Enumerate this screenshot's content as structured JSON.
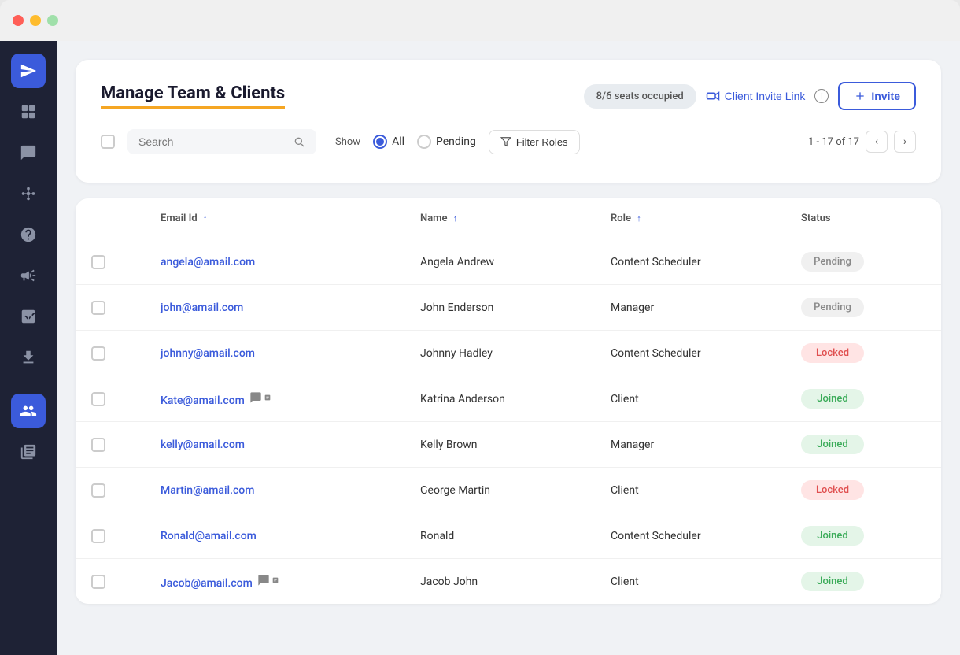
{
  "window": {
    "title": "Manage Team & Clients"
  },
  "header": {
    "title": "Manage Team & Clients",
    "seats_badge": "8/6 seats occupied",
    "invite_link_label": "Client Invite Link",
    "invite_button": "Invite"
  },
  "toolbar": {
    "search_placeholder": "Search",
    "show_label": "Show",
    "filter_button": "Filter Roles",
    "radio_all": "All",
    "radio_pending": "Pending",
    "pagination_text": "1 - 17 of 17"
  },
  "table": {
    "columns": [
      {
        "key": "email",
        "label": "Email Id",
        "sorted": true
      },
      {
        "key": "name",
        "label": "Name",
        "sorted": true
      },
      {
        "key": "role",
        "label": "Role",
        "sorted": true
      },
      {
        "key": "status",
        "label": "Status",
        "sorted": false
      }
    ],
    "rows": [
      {
        "email": "angela@amail.com",
        "name": "Angela Andrew",
        "role": "Content Scheduler",
        "status": "Pending",
        "has_icon": false
      },
      {
        "email": "john@amail.com",
        "name": "John Enderson",
        "role": "Manager",
        "status": "Pending",
        "has_icon": false
      },
      {
        "email": "johnny@amail.com",
        "name": "Johnny Hadley",
        "role": "Content Scheduler",
        "status": "Locked",
        "has_icon": false
      },
      {
        "email": "Kate@amail.com",
        "name": "Katrina Anderson",
        "role": "Client",
        "status": "Joined",
        "has_icon": true
      },
      {
        "email": "kelly@amail.com",
        "name": "Kelly Brown",
        "role": "Manager",
        "status": "Joined",
        "has_icon": false
      },
      {
        "email": "Martin@amail.com",
        "name": "George Martin",
        "role": "Client",
        "status": "Locked",
        "has_icon": false
      },
      {
        "email": "Ronald@amail.com",
        "name": "Ronald",
        "role": "Content Scheduler",
        "status": "Joined",
        "has_icon": false
      },
      {
        "email": "Jacob@amail.com",
        "name": "Jacob John",
        "role": "Client",
        "status": "Joined",
        "has_icon": true
      }
    ]
  },
  "sidebar": {
    "icons": [
      {
        "name": "navigation-icon",
        "label": "Navigate",
        "active": true
      },
      {
        "name": "dashboard-icon",
        "label": "Dashboard",
        "active": false
      },
      {
        "name": "chat-icon",
        "label": "Chat",
        "active": false
      },
      {
        "name": "network-icon",
        "label": "Network",
        "active": false
      },
      {
        "name": "support-icon",
        "label": "Support",
        "active": false
      },
      {
        "name": "megaphone-icon",
        "label": "Campaigns",
        "active": false
      },
      {
        "name": "analytics-icon",
        "label": "Analytics",
        "active": false
      },
      {
        "name": "download-icon",
        "label": "Downloads",
        "active": false
      },
      {
        "name": "team-icon",
        "label": "Team",
        "active": true
      },
      {
        "name": "library-icon",
        "label": "Library",
        "active": false
      }
    ]
  }
}
